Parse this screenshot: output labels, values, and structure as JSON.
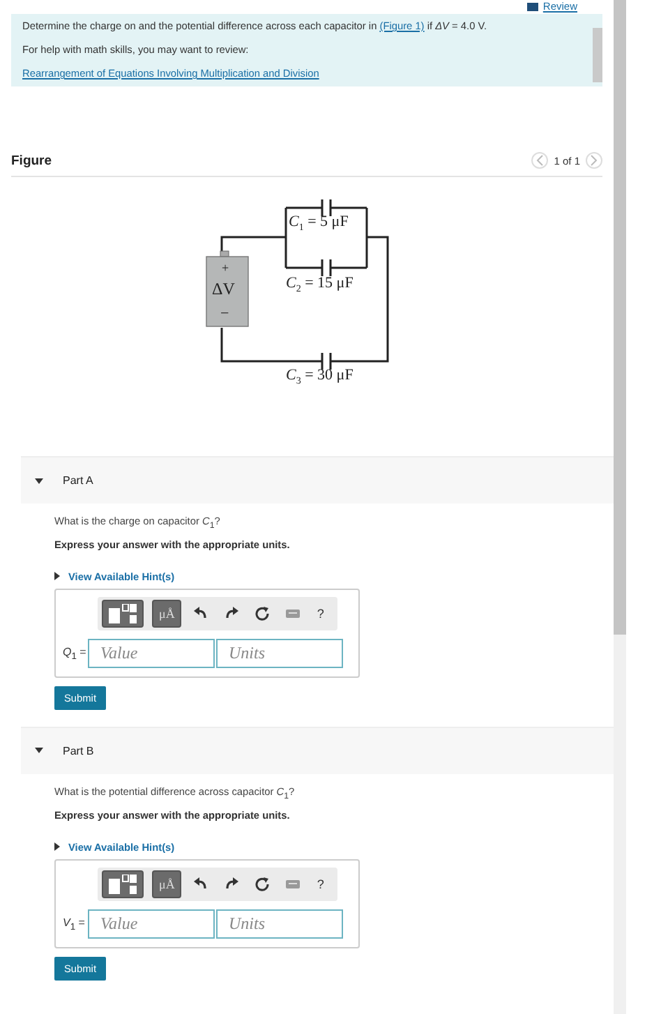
{
  "review_link": "Review",
  "prompt": {
    "text_before": "Determine the charge on and the potential difference across each capacitor in ",
    "figure_link": "(Figure 1)",
    "text_after": " if *ΔV* = 4.0 V.",
    "help_text": "For help with math skills, you may want to review:",
    "skill_link": "Rearrangement of Equations Involving Multiplication and Division"
  },
  "figure": {
    "title": "Figure",
    "pager": "1 of 1",
    "battery_plus": "+",
    "battery_label": "ΔV",
    "battery_minus": "−",
    "labels": [
      "*C*$_{1}$ = 5 μF",
      "*C*$_{2}$ = 15 μF",
      "*C*$_{3}$ = 30 μF"
    ]
  },
  "parts": [
    {
      "title": "Part A",
      "expanded": true,
      "question": "What is the charge on capacitor *C*$_{1}$?",
      "instruction": "Express your answer with the appropriate units.",
      "hint_link": "View Available Hint(s)",
      "units_button": "μÅ",
      "help_button": "?",
      "variable": "*Q*$_{1}$ =",
      "value_placeholder": "Value",
      "units_placeholder": "Units",
      "submit": "Submit"
    },
    {
      "title": "Part B",
      "expanded": true,
      "question": "What is the potential difference across capacitor *C*$_{1}$?",
      "instruction": "Express your answer with the appropriate units.",
      "hint_link": "View Available Hint(s)",
      "units_button": "μÅ",
      "help_button": "?",
      "variable": "*V*$_{1}$ =",
      "value_placeholder": "Value",
      "units_placeholder": "Units",
      "submit": "Submit"
    }
  ]
}
